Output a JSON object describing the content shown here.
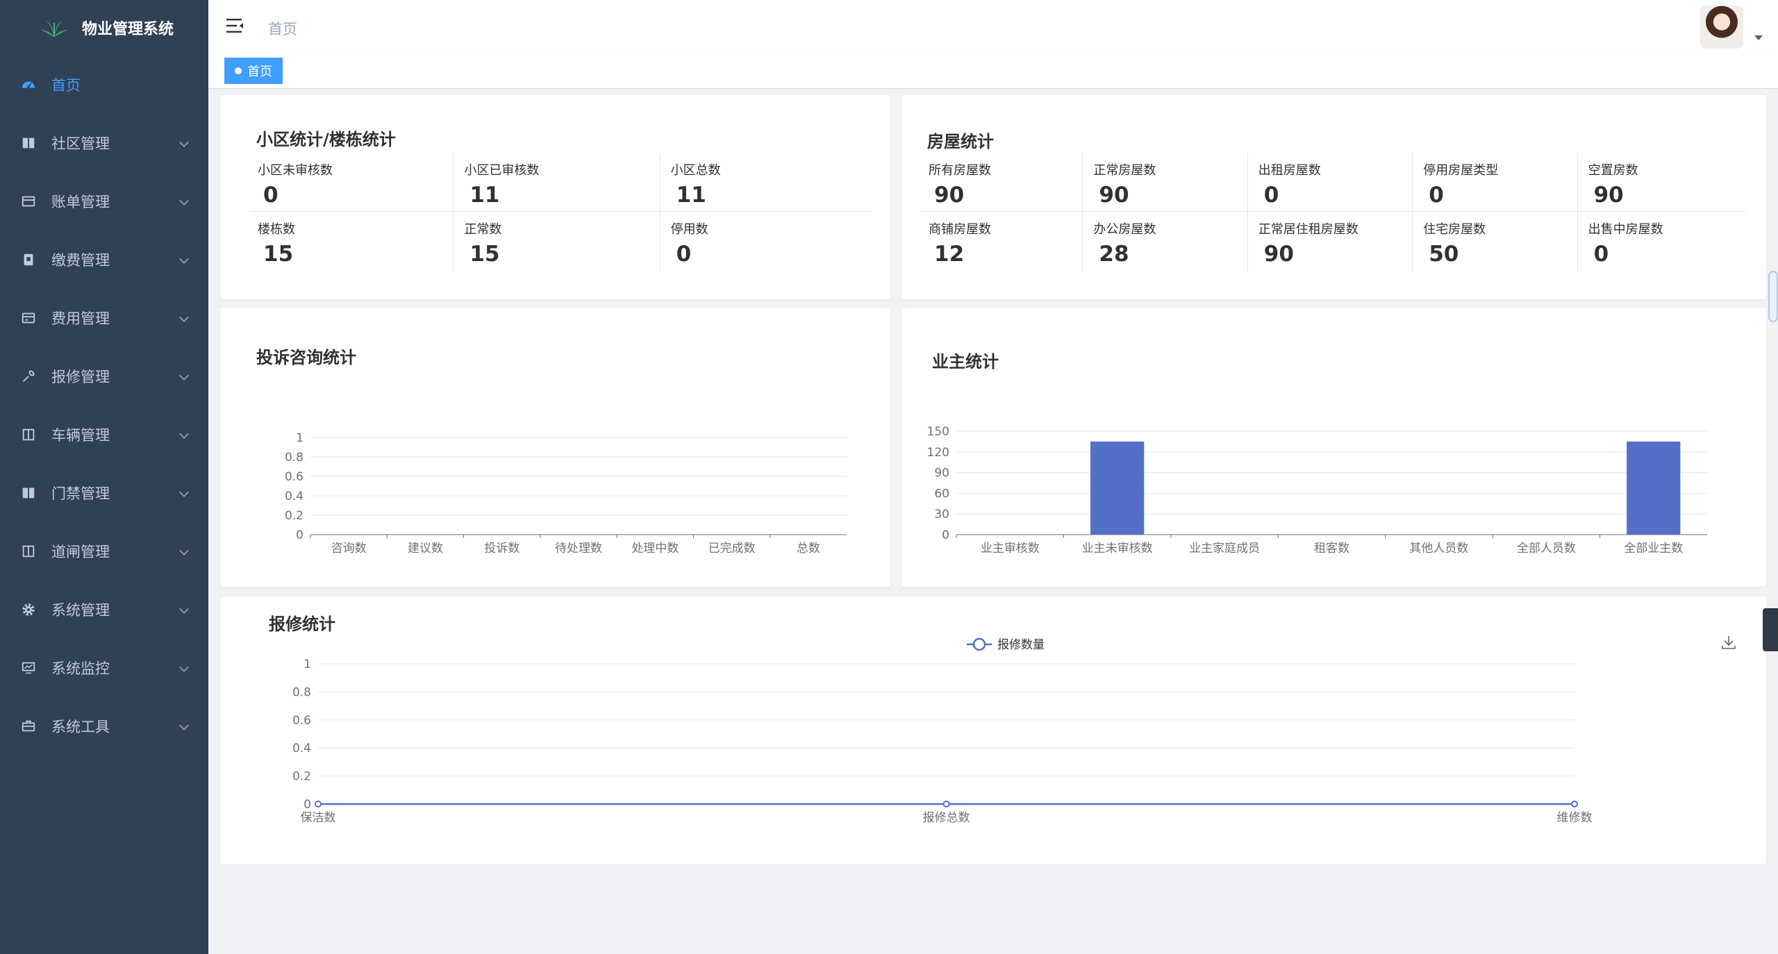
{
  "app": {
    "title": "物业管理系统"
  },
  "sidebar": {
    "items": [
      {
        "label": "首页",
        "icon": "dashboard-icon",
        "active": true
      },
      {
        "label": "社区管理",
        "icon": "book-icon"
      },
      {
        "label": "账单管理",
        "icon": "bill-icon"
      },
      {
        "label": "缴费管理",
        "icon": "wallet-icon"
      },
      {
        "label": "费用管理",
        "icon": "fee-icon"
      },
      {
        "label": "报修管理",
        "icon": "repair-icon"
      },
      {
        "label": "车辆管理",
        "icon": "car-icon"
      },
      {
        "label": "门禁管理",
        "icon": "door-icon"
      },
      {
        "label": "道闸管理",
        "icon": "gate-icon"
      },
      {
        "label": "系统管理",
        "icon": "gear-icon"
      },
      {
        "label": "系统监控",
        "icon": "monitor-icon"
      },
      {
        "label": "系统工具",
        "icon": "toolbox-icon"
      }
    ]
  },
  "header": {
    "breadcrumb": "首页"
  },
  "tags": {
    "active": "首页"
  },
  "community": {
    "title": "小区统计/楼栋统计",
    "row1": [
      {
        "label": "小区未审核数",
        "value": "0"
      },
      {
        "label": "小区已审核数",
        "value": "11"
      },
      {
        "label": "小区总数",
        "value": "11"
      }
    ],
    "row2": [
      {
        "label": "楼栋数",
        "value": "15"
      },
      {
        "label": "正常数",
        "value": "15"
      },
      {
        "label": "停用数",
        "value": "0"
      }
    ]
  },
  "house": {
    "title": "房屋统计",
    "row1": [
      {
        "label": "所有房屋数",
        "value": "90"
      },
      {
        "label": "正常房屋数",
        "value": "90"
      },
      {
        "label": "出租房屋数",
        "value": "0"
      },
      {
        "label": "停用房屋类型",
        "value": "0"
      },
      {
        "label": "空置房数",
        "value": "90"
      }
    ],
    "row2": [
      {
        "label": "商铺房屋数",
        "value": "12"
      },
      {
        "label": "办公房屋数",
        "value": "28"
      },
      {
        "label": "正常居住租房屋数",
        "value": "90"
      },
      {
        "label": "住宅房屋数",
        "value": "50"
      },
      {
        "label": "出售中房屋数",
        "value": "0"
      }
    ]
  },
  "complaint": {
    "title": "投诉咨询统计"
  },
  "owner": {
    "title": "业主统计"
  },
  "repair": {
    "title": "报修统计"
  },
  "colors": {
    "sidebar": "#304156",
    "accent": "#409eff",
    "bar": "#5470c6",
    "line": "#5470c6"
  },
  "chart_data": [
    {
      "type": "bar",
      "title": "投诉咨询统计",
      "categories": [
        "咨询数",
        "建议数",
        "投诉数",
        "待处理数",
        "处理中数",
        "已完成数",
        "总数"
      ],
      "values": [
        0,
        0,
        0,
        0,
        0,
        0,
        0
      ],
      "yticks": [
        "0",
        "0.2",
        "0.4",
        "0.6",
        "0.8",
        "1"
      ],
      "ylim": [
        0,
        1
      ],
      "grid": true
    },
    {
      "type": "bar",
      "title": "业主统计",
      "categories": [
        "业主审核数",
        "业主未审核数",
        "业主家庭成员",
        "租客数",
        "其他人员数",
        "全部人员数",
        "全部业主数"
      ],
      "values": [
        0,
        135,
        0,
        0,
        0,
        0,
        135
      ],
      "yticks": [
        "0",
        "30",
        "60",
        "90",
        "120",
        "150"
      ],
      "ylim": [
        0,
        150
      ],
      "grid": true
    },
    {
      "type": "line",
      "title": "报修统计",
      "categories": [
        "保洁数",
        "报修总数",
        "维修数"
      ],
      "series": [
        {
          "name": "报修数量",
          "values": [
            0,
            0,
            0
          ]
        }
      ],
      "yticks": [
        "0",
        "0.2",
        "0.4",
        "0.6",
        "0.8",
        "1"
      ],
      "ylim": [
        0,
        1
      ],
      "grid": true,
      "legend": "top-center"
    }
  ]
}
